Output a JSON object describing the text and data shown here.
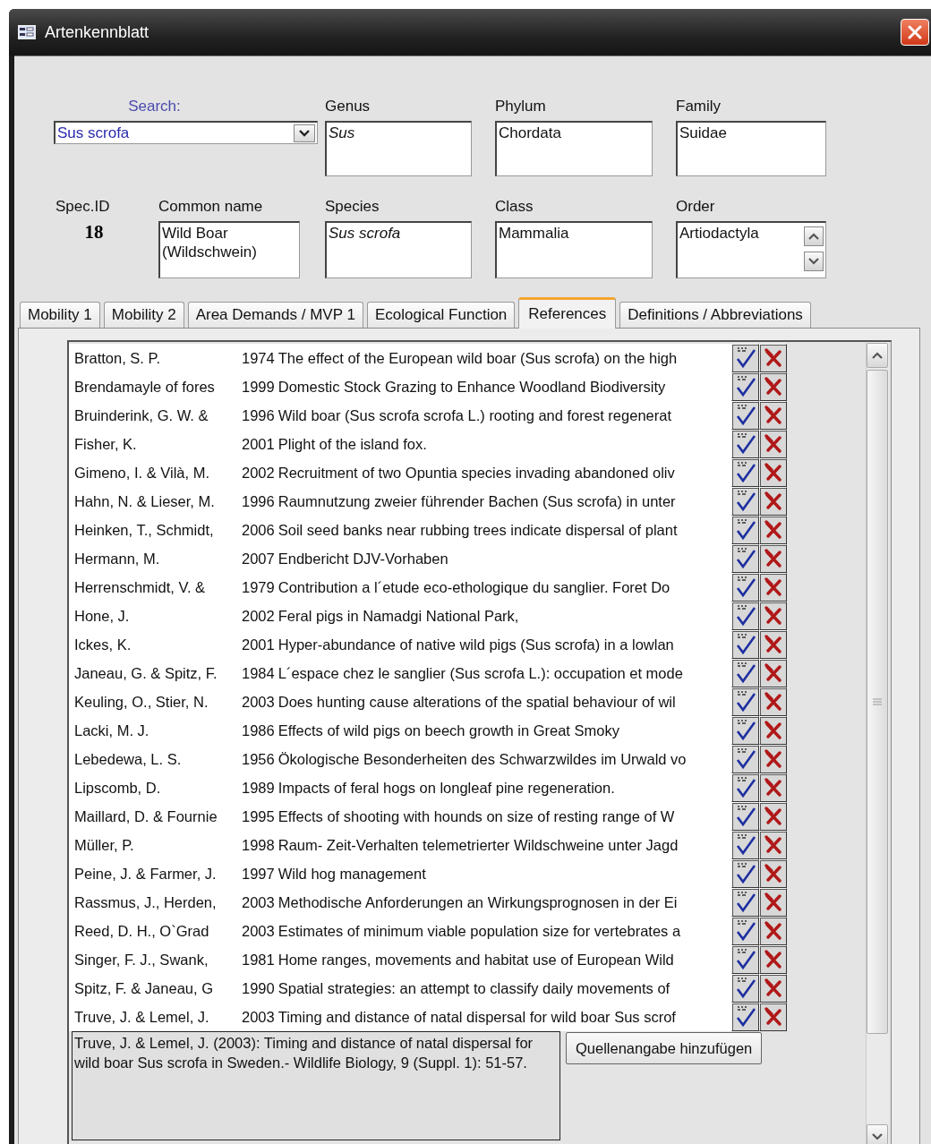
{
  "window": {
    "title": "Artenkennblatt"
  },
  "search": {
    "label": "Search:",
    "value": "Sus scrofa"
  },
  "spec_id": {
    "label": "Spec.ID",
    "value": "18"
  },
  "fields": [
    {
      "label": "Genus",
      "value": "Sus",
      "italic": true
    },
    {
      "label": "Phylum",
      "value": "Chordata",
      "italic": false
    },
    {
      "label": "Family",
      "value": "Suidae",
      "italic": false
    },
    {
      "label": "Common name",
      "value": "Wild Boar (Wildschwein)",
      "italic": false
    },
    {
      "label": "Species",
      "value": "Sus scrofa",
      "italic": true
    },
    {
      "label": "Class",
      "value": "Mammalia",
      "italic": false
    },
    {
      "label": "Order",
      "value": "Artiodactyla",
      "italic": false
    }
  ],
  "tabs": [
    {
      "label": "Mobility 1",
      "selected": false
    },
    {
      "label": "Mobility 2",
      "selected": false
    },
    {
      "label": "Area Demands / MVP 1",
      "selected": false
    },
    {
      "label": "Ecological Function",
      "selected": false
    },
    {
      "label": "References",
      "selected": true
    },
    {
      "label": "Definitions / Abbreviations",
      "selected": false
    }
  ],
  "references": [
    {
      "author": "Bratton, S. P.",
      "year": "1974",
      "title": "The effect of the European wild boar (Sus scrofa) on the high"
    },
    {
      "author": "Brendamayle of fores",
      "year": "1999",
      "title": "Domestic Stock Grazing to Enhance Woodland Biodiversity"
    },
    {
      "author": "Bruinderink, G. W. &",
      "year": "1996",
      "title": "Wild boar (Sus scrofa scrofa L.) rooting and forest regenerat"
    },
    {
      "author": "Fisher, K.",
      "year": "2001",
      "title": "Plight of the island fox."
    },
    {
      "author": "Gimeno, I. & Vilà, M.",
      "year": "2002",
      "title": "Recruitment of two Opuntia species invading abandoned oliv"
    },
    {
      "author": "Hahn, N. & Lieser, M.",
      "year": "1996",
      "title": "Raumnutzung zweier führender Bachen (Sus scrofa) in unter"
    },
    {
      "author": "Heinken, T., Schmidt,",
      "year": "2006",
      "title": "Soil seed banks near rubbing trees indicate dispersal of plant"
    },
    {
      "author": "Hermann, M.",
      "year": "2007",
      "title": "Endbericht DJV-Vorhaben"
    },
    {
      "author": "Herrenschmidt, V. &",
      "year": "1979",
      "title": "Contribution a l´etude eco-ethologique du sanglier. Foret Do"
    },
    {
      "author": "Hone, J.",
      "year": "2002",
      "title": "Feral pigs in Namadgi National Park,"
    },
    {
      "author": "Ickes, K.",
      "year": "2001",
      "title": "Hyper-abundance of native wild pigs (Sus scrofa) in a lowlan"
    },
    {
      "author": "Janeau, G. & Spitz, F.",
      "year": "1984",
      "title": "L´espace chez le sanglier (Sus scrofa L.): occupation et mode"
    },
    {
      "author": "Keuling, O., Stier, N.",
      "year": "2003",
      "title": "Does hunting cause alterations of the spatial behaviour of wil"
    },
    {
      "author": "Lacki, M. J.",
      "year": "1986",
      "title": "Effects of wild pigs on beech growth in Great Smoky"
    },
    {
      "author": "Lebedewa, L. S.",
      "year": "1956",
      "title": "Ökologische Besonderheiten des Schwarzwildes im Urwald vo"
    },
    {
      "author": "Lipscomb, D.",
      "year": "1989",
      "title": "Impacts of feral hogs on longleaf pine regeneration."
    },
    {
      "author": "Maillard, D. & Fournie",
      "year": "1995",
      "title": "Effects of shooting with hounds on size of resting range of W"
    },
    {
      "author": "Müller, P.",
      "year": "1998",
      "title": "Raum- Zeit-Verhalten telemetrierter Wildschweine unter Jagd"
    },
    {
      "author": "Peine, J. & Farmer, J.",
      "year": "1997",
      "title": "Wild hog management"
    },
    {
      "author": "Rassmus, J., Herden,",
      "year": "2003",
      "title": "Methodische Anforderungen an Wirkungsprognosen in der Ei"
    },
    {
      "author": "Reed, D. H., O`Grad",
      "year": "2003",
      "title": "Estimates of minimum viable population size for vertebrates a"
    },
    {
      "author": "Singer, F. J., Swank,",
      "year": "1981",
      "title": "Home ranges, movements and habitat use of European Wild"
    },
    {
      "author": "Spitz, F. & Janeau, G",
      "year": "1990",
      "title": "Spatial strategies: an attempt to classify daily movements of"
    },
    {
      "author": "Truve, J. & Lemel, J.",
      "year": "2003",
      "title": "Timing and distance of natal dispersal for wild boar Sus scrof"
    }
  ],
  "citation": "Truve, J. & Lemel, J. (2003): Timing and distance of natal dispersal for wild boar Sus scrofa in Sweden.- Wildlife Biology, 9 (Suppl. 1): 51-57.",
  "add_button": "Quellenangabe hinzufügen"
}
